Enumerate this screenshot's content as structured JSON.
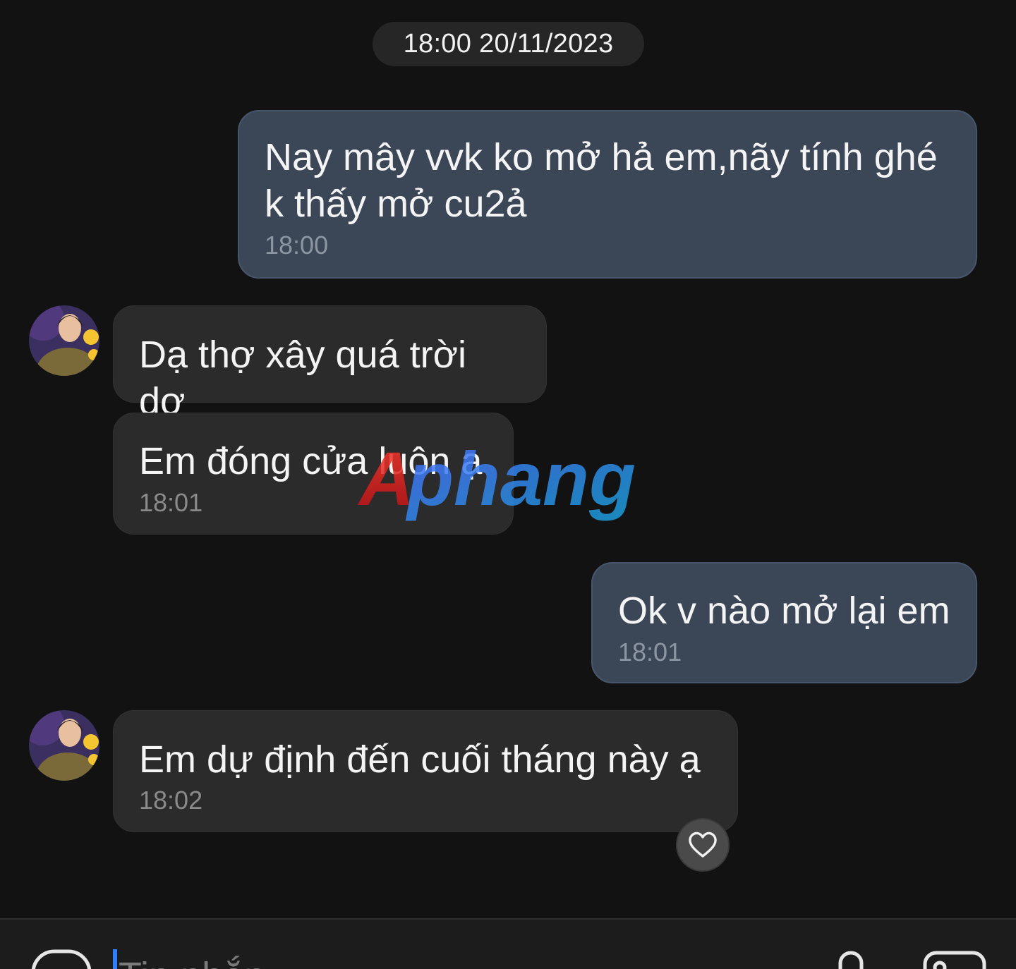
{
  "date_divider": "18:00 20/11/2023",
  "messages": [
    {
      "direction": "outgoing",
      "text": "Nay mây vvk ko mở hả em,nãy tính ghé k thấy mở cu2ả",
      "time": "18:00"
    },
    {
      "direction": "incoming",
      "text": "Dạ thợ xây quá trời dơ",
      "time": ""
    },
    {
      "direction": "incoming",
      "text": "Em đóng cửa luôn ạ",
      "time": "18:01"
    },
    {
      "direction": "outgoing",
      "text": "Ok v nào mở lại em",
      "time": "18:01"
    },
    {
      "direction": "incoming",
      "text": "Em dự định đến cuối tháng này ạ",
      "time": "18:02"
    }
  ],
  "watermark_text": "Aphang",
  "composer": {
    "placeholder": "Tin nhắn",
    "value": ""
  },
  "colors": {
    "background": "#121212",
    "outgoing_bubble": "#3b4757",
    "incoming_bubble": "#2b2b2b",
    "accent": "#2f80ff"
  }
}
